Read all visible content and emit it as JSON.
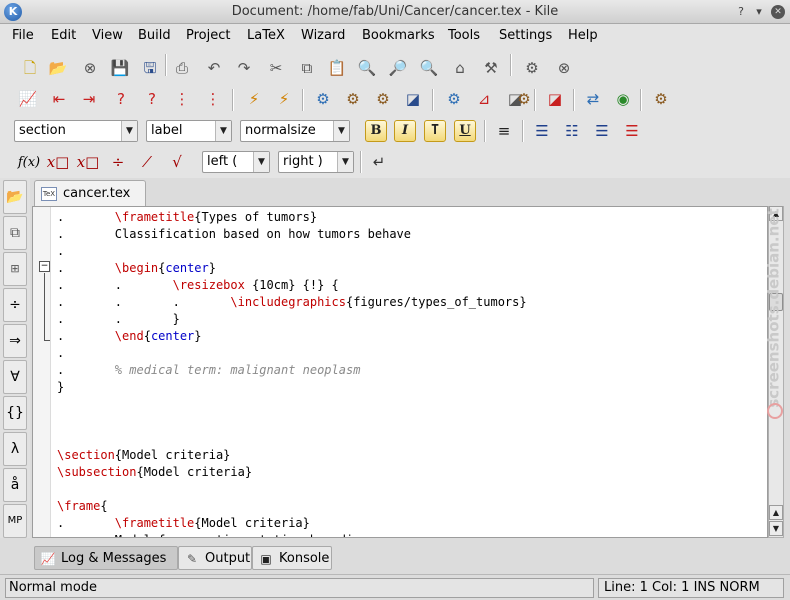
{
  "window": {
    "title": "Document: /home/fab/Uni/Cancer/cancer.tex - Kile",
    "app_icon_letter": "K"
  },
  "menu": [
    "File",
    "Edit",
    "View",
    "Build",
    "Project",
    "LaTeX",
    "Wizard",
    "Bookmarks",
    "Tools",
    "Settings",
    "Help"
  ],
  "toolbar": {
    "section_combo": "section",
    "label_combo": "label",
    "size_combo": "normalsize",
    "format_buttons": [
      "B",
      "I",
      "T",
      "U"
    ],
    "math_buttons": [
      "f(x)"
    ],
    "left_combo": "left (",
    "right_combo": "right )"
  },
  "editor": {
    "tab_label": "cancer.tex",
    "tab_icon_text": "TeX",
    "lines": [
      {
        "t": [
          [
            ".       ",
            ""
          ],
          [
            "\\frametitle",
            "kw"
          ],
          [
            "{Types of tumors}",
            ""
          ]
        ]
      },
      {
        "t": [
          [
            ".       Classification based on how tumors behave",
            ""
          ]
        ]
      },
      {
        "t": [
          [
            ".",
            ""
          ]
        ]
      },
      {
        "t": [
          [
            ".       ",
            ""
          ],
          [
            "\\begin",
            "kw"
          ],
          [
            "{",
            ""
          ],
          [
            "center",
            "arg"
          ],
          [
            "}",
            ""
          ]
        ]
      },
      {
        "t": [
          [
            ".       .       ",
            ""
          ],
          [
            "\\resizebox",
            "kw"
          ],
          [
            " {10cm} {!} {",
            ""
          ]
        ]
      },
      {
        "t": [
          [
            ".       .       .       ",
            ""
          ],
          [
            "\\includegraphics",
            "kw"
          ],
          [
            "{figures/types_of_tumors}",
            ""
          ]
        ]
      },
      {
        "t": [
          [
            ".       .       }",
            ""
          ]
        ]
      },
      {
        "t": [
          [
            ".       ",
            ""
          ],
          [
            "\\end",
            "kw"
          ],
          [
            "{",
            ""
          ],
          [
            "center",
            "arg"
          ],
          [
            "}",
            ""
          ]
        ]
      },
      {
        "t": [
          [
            ".",
            ""
          ]
        ]
      },
      {
        "t": [
          [
            ".       ",
            ""
          ],
          [
            "% medical term: malignant neoplasm",
            "cm"
          ]
        ]
      },
      {
        "t": [
          [
            "}",
            ""
          ]
        ]
      },
      {
        "t": [
          [
            "",
            ""
          ]
        ]
      },
      {
        "t": [
          [
            "",
            ""
          ]
        ]
      },
      {
        "t": [
          [
            "",
            ""
          ]
        ]
      },
      {
        "t": [
          [
            "\\section",
            "kw"
          ],
          [
            "{Model criteria}",
            ""
          ]
        ]
      },
      {
        "t": [
          [
            "\\subsection",
            "kw"
          ],
          [
            "{Model criteria}",
            ""
          ]
        ]
      },
      {
        "t": [
          [
            "",
            ""
          ]
        ]
      },
      {
        "t": [
          [
            "\\frame",
            "kw"
          ],
          [
            "{",
            ""
          ]
        ]
      },
      {
        "t": [
          [
            ".       ",
            ""
          ],
          [
            "\\frametitle",
            "kw"
          ],
          [
            "{Model criteria}",
            ""
          ]
        ]
      },
      {
        "t": [
          [
            ".       Model for somatic mutation breeding cancer",
            ""
          ]
        ]
      }
    ]
  },
  "bottom_tabs": [
    "Log & Messages",
    "Output",
    "Konsole"
  ],
  "status": {
    "mode": "Normal mode",
    "position": "Line: 1 Col: 1  INS  NORM"
  },
  "watermark": "screenshots.debian.net"
}
